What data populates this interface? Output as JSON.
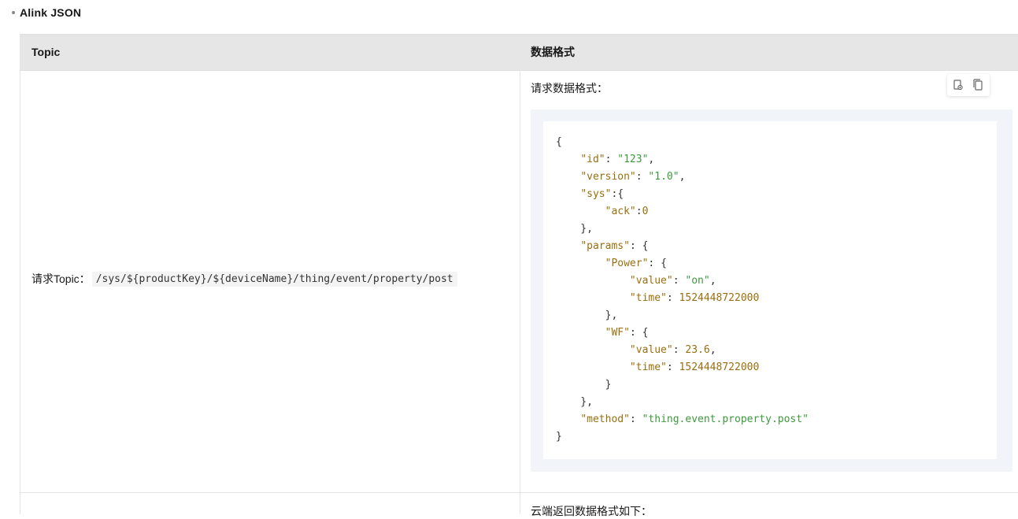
{
  "heading": "Alink JSON",
  "table": {
    "headers": {
      "topic": "Topic",
      "format": "数据格式"
    },
    "row1": {
      "topic_label": "请求Topic：",
      "topic_value": "/sys/${productKey}/${deviceName}/thing/event/property/post",
      "format_label": "请求数据格式：",
      "code_lines": [
        "{",
        "    \"id\": \"123\",",
        "    \"version\": \"1.0\",",
        "    \"sys\":{",
        "        \"ack\":0",
        "    },",
        "    \"params\": {",
        "        \"Power\": {",
        "            \"value\": \"on\",",
        "            \"time\": 1524448722000",
        "        },",
        "        \"WF\": {",
        "            \"value\": 23.6,",
        "            \"time\": 1524448722000",
        "        }",
        "    },",
        "    \"method\": \"thing.event.property.post\"",
        "}"
      ]
    },
    "row2": {
      "format_label_partial": "云端返回数据格式如下："
    }
  },
  "toolbar": {
    "icons": [
      "copy-to-clipboard-icon",
      "copy-icon"
    ]
  },
  "colors": {
    "key": "#9a6e0f",
    "string": "#3d9a3d",
    "number": "#9a6e0f",
    "header_bg": "#e6e6e6",
    "code_bg": "#f1f4f8"
  }
}
